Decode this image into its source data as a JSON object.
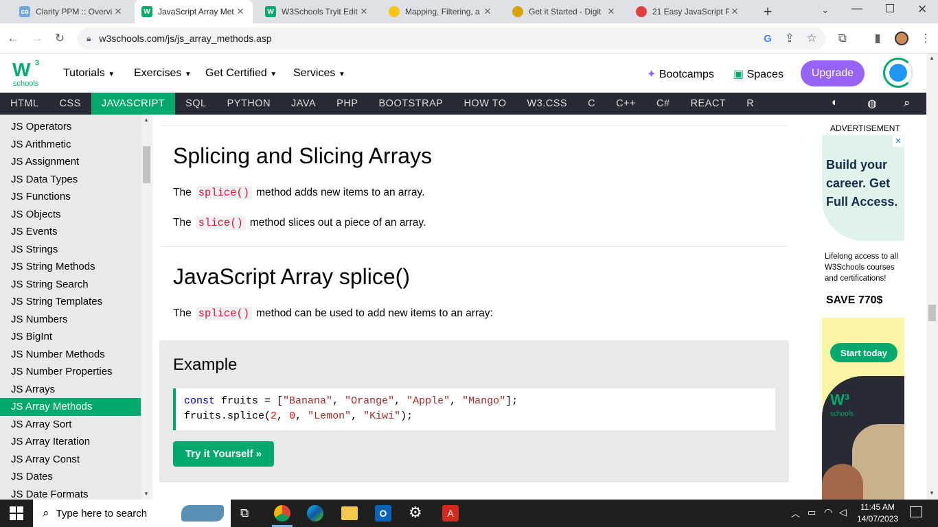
{
  "browser": {
    "tabs": [
      {
        "title": "Clarity PPM :: Overvie",
        "active": false
      },
      {
        "title": "JavaScript Array Met",
        "active": true
      },
      {
        "title": "W3Schools Tryit Edit",
        "active": false
      },
      {
        "title": "Mapping, Filtering, a",
        "active": false
      },
      {
        "title": "Get it Started - Digit",
        "active": false
      },
      {
        "title": "21 Easy JavaScript Pr",
        "active": false
      }
    ],
    "url": "w3schools.com/js/js_array_methods.asp"
  },
  "w3header": {
    "logo_top": "W",
    "logo_sup": "3",
    "logo_bottom": "schools",
    "menus": [
      "Tutorials",
      "Exercises",
      "Get Certified",
      "Services"
    ],
    "bootcamps": "Bootcamps",
    "spaces": "Spaces",
    "upgrade": "Upgrade"
  },
  "topnav": {
    "items": [
      "HTML",
      "CSS",
      "JAVASCRIPT",
      "SQL",
      "PYTHON",
      "JAVA",
      "PHP",
      "BOOTSTRAP",
      "HOW TO",
      "W3.CSS",
      "C",
      "C++",
      "C#",
      "REACT",
      "R"
    ],
    "active": "JAVASCRIPT"
  },
  "sidebar": {
    "items": [
      "JS Operators",
      "JS Arithmetic",
      "JS Assignment",
      "JS Data Types",
      "JS Functions",
      "JS Objects",
      "JS Events",
      "JS Strings",
      "JS String Methods",
      "JS String Search",
      "JS String Templates",
      "JS Numbers",
      "JS BigInt",
      "JS Number Methods",
      "JS Number Properties",
      "JS Arrays",
      "JS Array Methods",
      "JS Array Sort",
      "JS Array Iteration",
      "JS Array Const",
      "JS Dates",
      "JS Date Formats"
    ],
    "active": "JS Array Methods"
  },
  "main": {
    "h1": "Splicing and Slicing Arrays",
    "p1": {
      "pre": "The",
      "code": "splice()",
      "post": "method adds new items to an array."
    },
    "p2": {
      "pre": "The",
      "code": "slice()",
      "post": "method slices out a piece of an array."
    },
    "h2": "JavaScript Array splice()",
    "p3": {
      "pre": "The",
      "code": "splice()",
      "post": "method can be used to add new items to an array:"
    },
    "example_title": "Example",
    "try_button": "Try it Yourself »"
  },
  "ad": {
    "label": "ADVERTISEMENT",
    "headline_1": "Build your",
    "headline_2": "career. Get",
    "headline_3": "Full Access.",
    "body_1": "Lifelong access to all",
    "body_2": "W3Schools courses",
    "body_3": "and certifications!",
    "save": "SAVE 770$",
    "cta": "Start today",
    "logo_text": "schools"
  },
  "taskbar": {
    "search_placeholder": "Type here to search",
    "time": "11:45 AM",
    "date": "14/07/2023"
  }
}
